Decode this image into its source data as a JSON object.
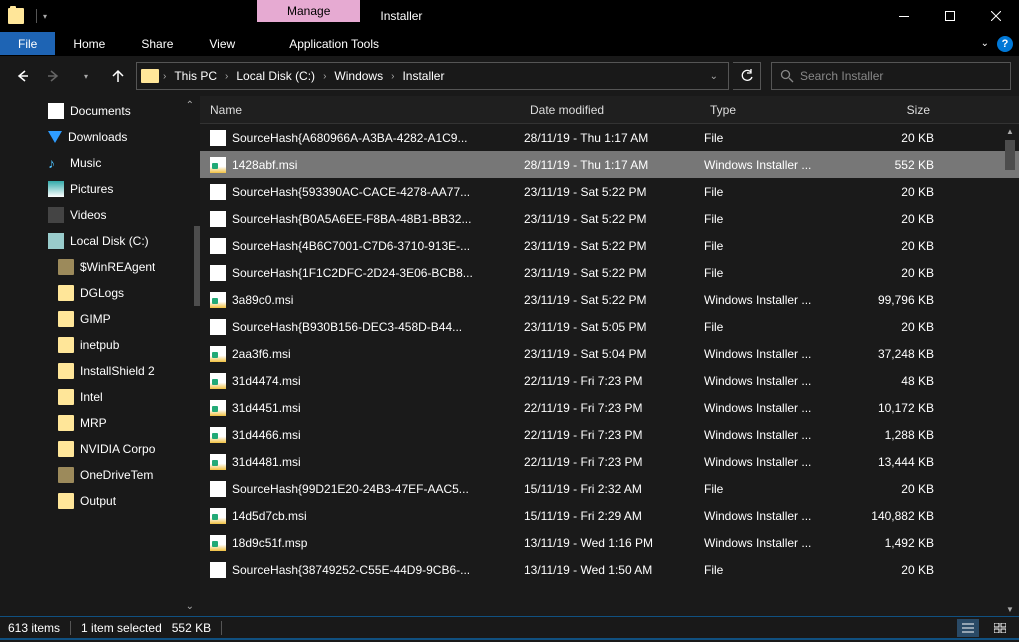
{
  "title": "Installer",
  "context_tab_header": "Manage",
  "ribbon": {
    "file": "File",
    "tabs": [
      "Home",
      "Share",
      "View"
    ],
    "context_tab": "Application Tools"
  },
  "breadcrumb": [
    "This PC",
    "Local Disk (C:)",
    "Windows",
    "Installer"
  ],
  "search_placeholder": "Search Installer",
  "tree": [
    {
      "label": "Documents",
      "icon": "doc",
      "lvl": 1
    },
    {
      "label": "Downloads",
      "icon": "down",
      "lvl": 1
    },
    {
      "label": "Music",
      "icon": "music",
      "lvl": 1
    },
    {
      "label": "Pictures",
      "icon": "pic",
      "lvl": 1
    },
    {
      "label": "Videos",
      "icon": "vid",
      "lvl": 1
    },
    {
      "label": "Local Disk (C:)",
      "icon": "disk",
      "lvl": 1
    },
    {
      "label": "$WinREAgent",
      "icon": "folder-dim",
      "lvl": 2
    },
    {
      "label": "DGLogs",
      "icon": "folder",
      "lvl": 2
    },
    {
      "label": "GIMP",
      "icon": "folder",
      "lvl": 2
    },
    {
      "label": "inetpub",
      "icon": "folder",
      "lvl": 2
    },
    {
      "label": "InstallShield 2",
      "icon": "folder",
      "lvl": 2
    },
    {
      "label": "Intel",
      "icon": "folder",
      "lvl": 2
    },
    {
      "label": "MRP",
      "icon": "folder",
      "lvl": 2
    },
    {
      "label": "NVIDIA Corpo",
      "icon": "folder",
      "lvl": 2
    },
    {
      "label": "OneDriveTem",
      "icon": "folder-dim",
      "lvl": 2
    },
    {
      "label": "Output",
      "icon": "folder",
      "lvl": 2
    }
  ],
  "columns": {
    "name": "Name",
    "date": "Date modified",
    "type": "Type",
    "size": "Size"
  },
  "files": [
    {
      "name": "SourceHash{A680966A-A3BA-4282-A1C9...",
      "date": "28/11/19 - Thu 1:17 AM",
      "type": "File",
      "size": "20 KB",
      "ico": "file",
      "sel": false
    },
    {
      "name": "1428abf.msi",
      "date": "28/11/19 - Thu 1:17 AM",
      "type": "Windows Installer ...",
      "size": "552 KB",
      "ico": "msi",
      "sel": true
    },
    {
      "name": "SourceHash{593390AC-CACE-4278-AA77...",
      "date": "23/11/19 - Sat 5:22 PM",
      "type": "File",
      "size": "20 KB",
      "ico": "file"
    },
    {
      "name": "SourceHash{B0A5A6EE-F8BA-48B1-BB32...",
      "date": "23/11/19 - Sat 5:22 PM",
      "type": "File",
      "size": "20 KB",
      "ico": "file"
    },
    {
      "name": "SourceHash{4B6C7001-C7D6-3710-913E-...",
      "date": "23/11/19 - Sat 5:22 PM",
      "type": "File",
      "size": "20 KB",
      "ico": "file"
    },
    {
      "name": "SourceHash{1F1C2DFC-2D24-3E06-BCB8...",
      "date": "23/11/19 - Sat 5:22 PM",
      "type": "File",
      "size": "20 KB",
      "ico": "file"
    },
    {
      "name": "3a89c0.msi",
      "date": "23/11/19 - Sat 5:22 PM",
      "type": "Windows Installer ...",
      "size": "99,796 KB",
      "ico": "msi"
    },
    {
      "name": "SourceHash{B930B156-DEC3-458D-B44...",
      "date": "23/11/19 - Sat 5:05 PM",
      "type": "File",
      "size": "20 KB",
      "ico": "file"
    },
    {
      "name": "2aa3f6.msi",
      "date": "23/11/19 - Sat 5:04 PM",
      "type": "Windows Installer ...",
      "size": "37,248 KB",
      "ico": "msi"
    },
    {
      "name": "31d4474.msi",
      "date": "22/11/19 - Fri 7:23 PM",
      "type": "Windows Installer ...",
      "size": "48 KB",
      "ico": "msi"
    },
    {
      "name": "31d4451.msi",
      "date": "22/11/19 - Fri 7:23 PM",
      "type": "Windows Installer ...",
      "size": "10,172 KB",
      "ico": "msi"
    },
    {
      "name": "31d4466.msi",
      "date": "22/11/19 - Fri 7:23 PM",
      "type": "Windows Installer ...",
      "size": "1,288 KB",
      "ico": "msi"
    },
    {
      "name": "31d4481.msi",
      "date": "22/11/19 - Fri 7:23 PM",
      "type": "Windows Installer ...",
      "size": "13,444 KB",
      "ico": "msi"
    },
    {
      "name": "SourceHash{99D21E20-24B3-47EF-AAC5...",
      "date": "15/11/19 - Fri 2:32 AM",
      "type": "File",
      "size": "20 KB",
      "ico": "file"
    },
    {
      "name": "14d5d7cb.msi",
      "date": "15/11/19 - Fri 2:29 AM",
      "type": "Windows Installer ...",
      "size": "140,882 KB",
      "ico": "msi"
    },
    {
      "name": "18d9c51f.msp",
      "date": "13/11/19 - Wed 1:16 PM",
      "type": "Windows Installer ...",
      "size": "1,492 KB",
      "ico": "msi"
    },
    {
      "name": "SourceHash{38749252-C55E-44D9-9CB6-...",
      "date": "13/11/19 - Wed 1:50 AM",
      "type": "File",
      "size": "20 KB",
      "ico": "file"
    }
  ],
  "status": {
    "count": "613 items",
    "selection": "1 item selected",
    "size": "552 KB"
  }
}
